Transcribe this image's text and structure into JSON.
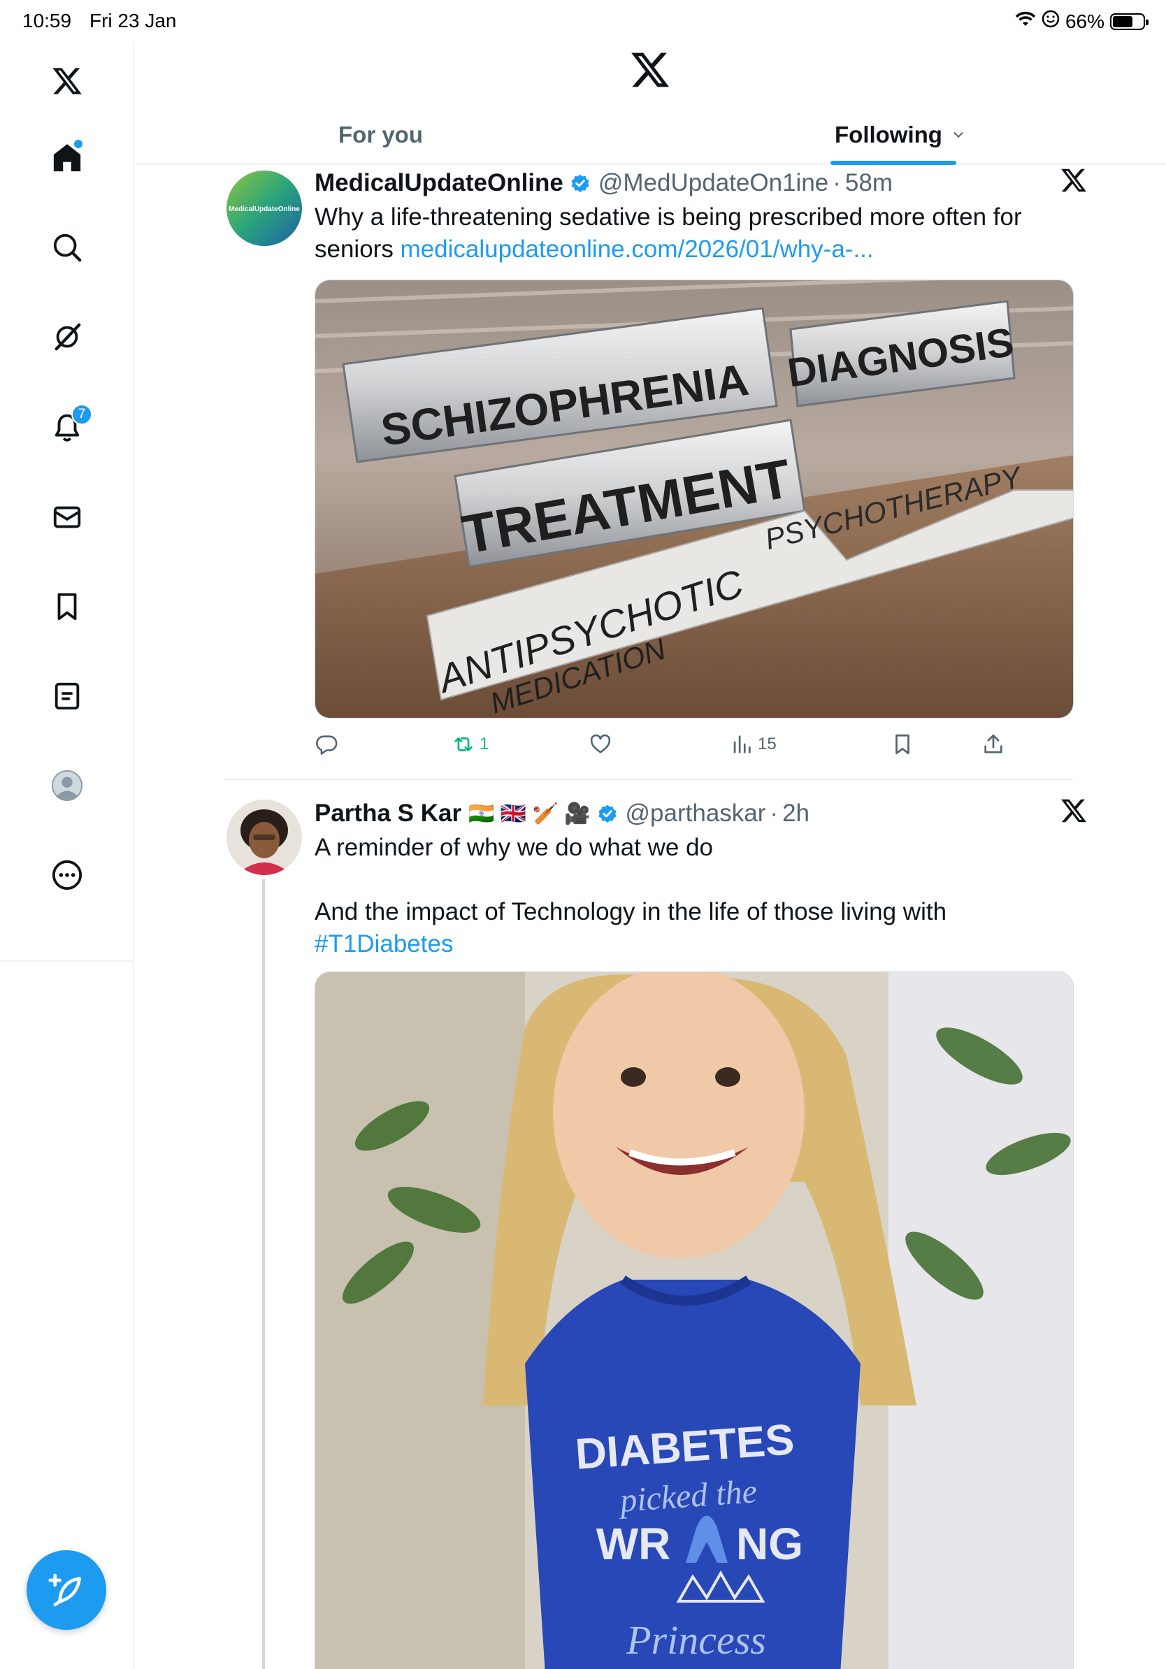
{
  "status_bar": {
    "time": "10:59",
    "date": "Fri 23 Jan",
    "battery": "66%",
    "battery_level": 0.66
  },
  "sidebar": {
    "items": [
      {
        "name": "home-icon",
        "active": true
      },
      {
        "name": "search-icon"
      },
      {
        "name": "grok-icon"
      },
      {
        "name": "notifications-icon",
        "badge": "7"
      },
      {
        "name": "messages-icon"
      },
      {
        "name": "bookmarks-icon"
      },
      {
        "name": "lists-icon"
      },
      {
        "name": "profile-icon"
      },
      {
        "name": "more-icon"
      }
    ],
    "compose_icon": "compose-icon"
  },
  "header": {
    "tabs": [
      {
        "label": "For you",
        "selected": false
      },
      {
        "label": "Following",
        "selected": true
      }
    ]
  },
  "colors": {
    "accent": "#1d9bf0",
    "text": "#0f1419",
    "muted": "#536471",
    "repost_green": "#00ba7c"
  },
  "posts": [
    {
      "display_name": "MedicalUpdateOnline",
      "handle": "@MedUpdateOn1ine",
      "time": "58m",
      "avatar_text": "MedicalUpdateOnline",
      "text_before_link": "Why a life-threatening sedative is being prescribed more often for seniors ",
      "link": "medicalupdateonline.com/2026/01/why-a-...",
      "image_labels": [
        "SCHIZOPHRENIA",
        "DIAGNOSIS",
        "TREATMENT",
        "PSYCHOTHERAPY",
        "ANTIPSYCHOTIC",
        "MEDICATION"
      ],
      "actions": {
        "reposts": "1",
        "views": "15"
      }
    },
    {
      "display_name": "Partha S Kar",
      "handle": "@parthaskar",
      "time": "2h",
      "flags": "🇮🇳 🇬🇧 🏏 🎥",
      "line1": "A reminder of why we do what we do",
      "line2": "And the impact of Technology in the life of those living with",
      "hashtag": "#T1Diabetes",
      "shirt_text": [
        "DIABETES",
        "picked the",
        "WR",
        "NG",
        "Princess"
      ]
    }
  ]
}
